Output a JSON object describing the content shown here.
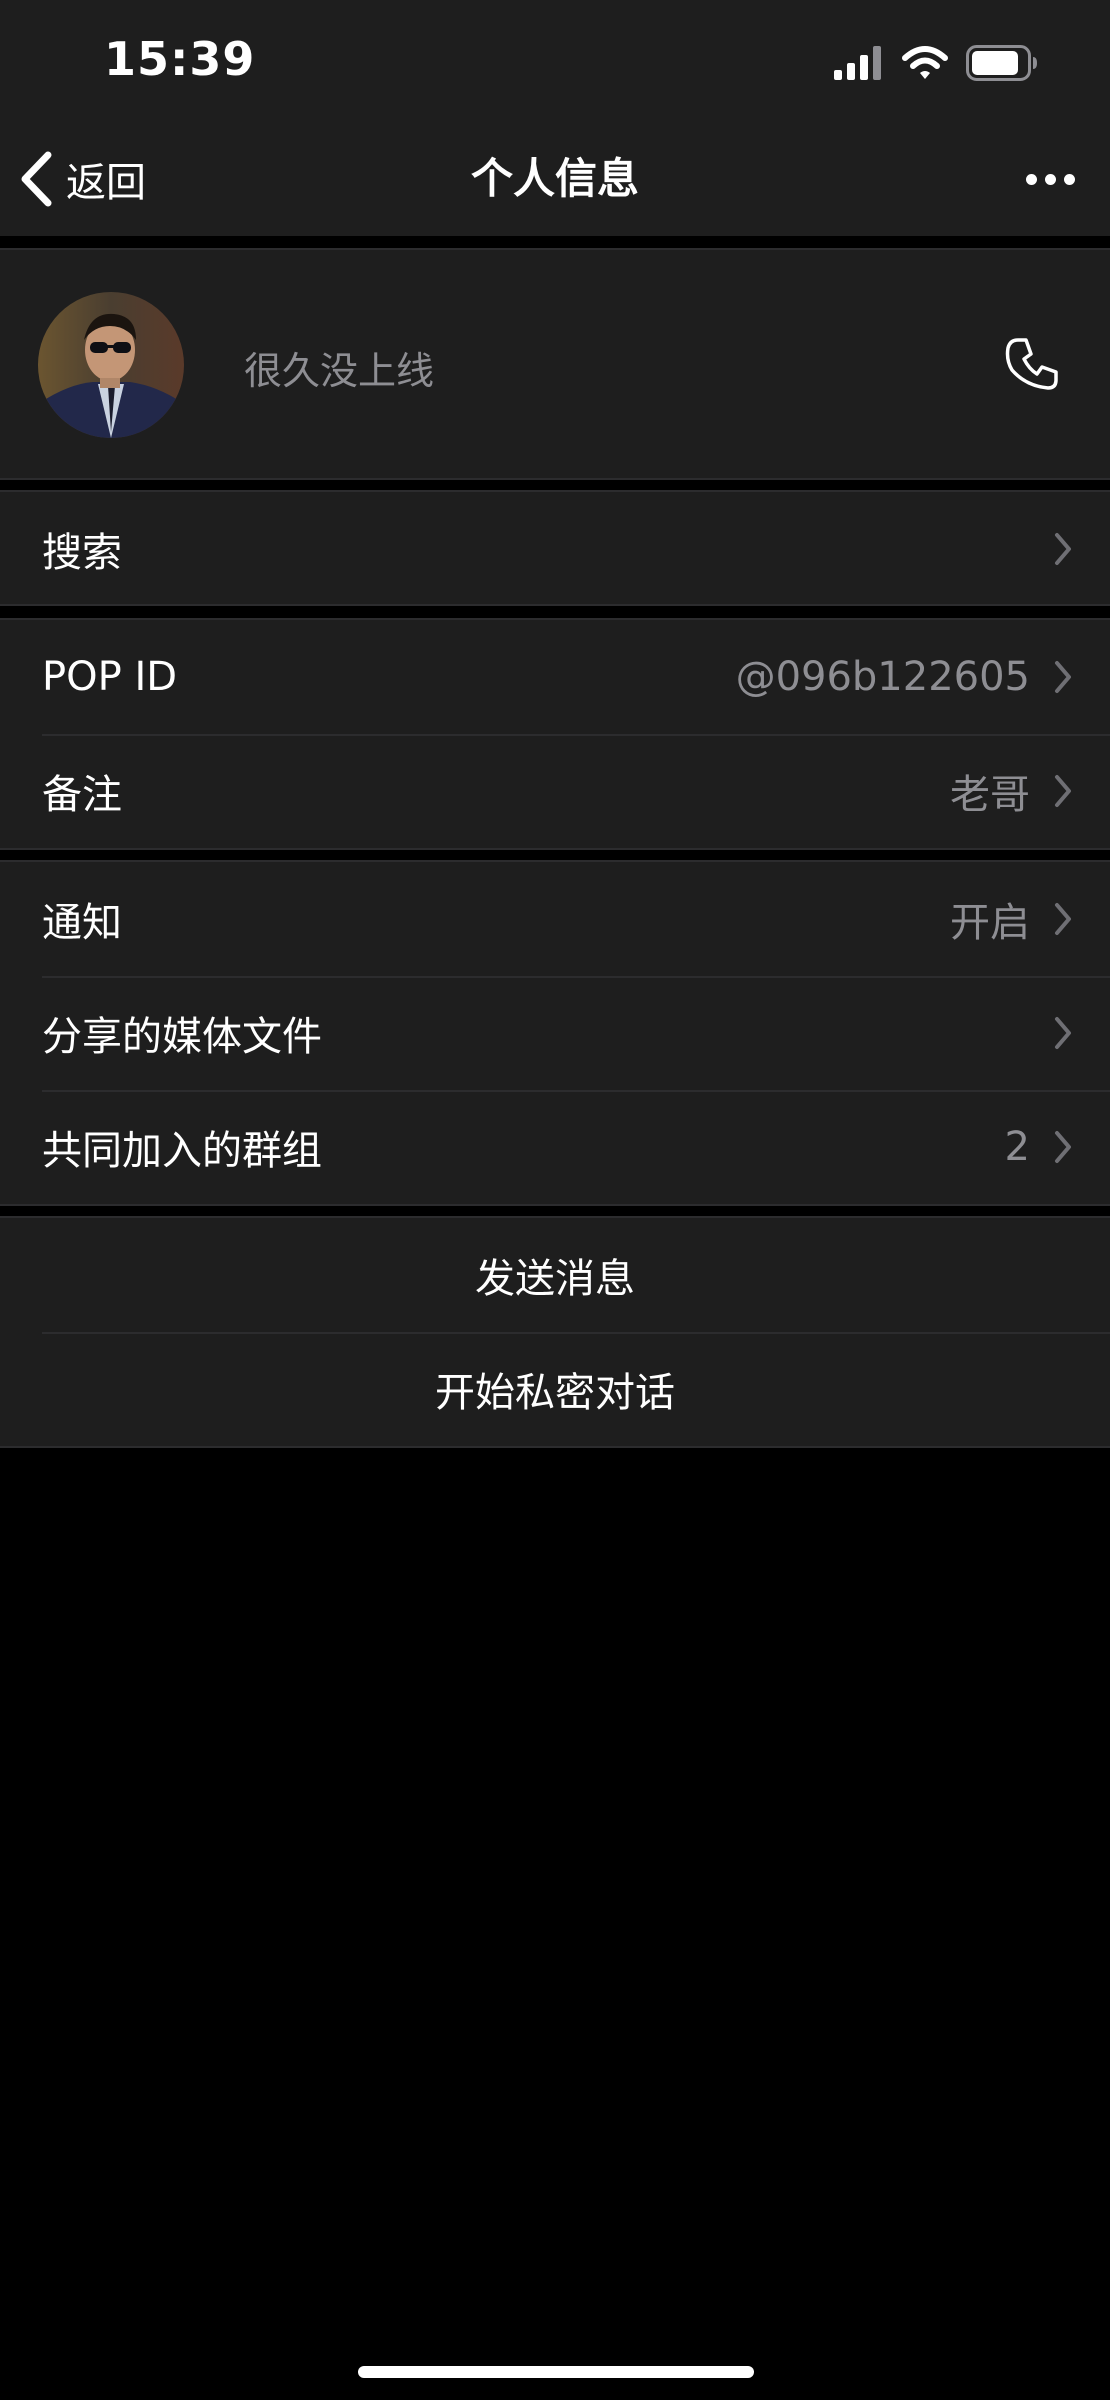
{
  "status_bar": {
    "time": "15:39",
    "icons": [
      "signal-icon",
      "wifi-icon",
      "battery-icon"
    ]
  },
  "nav": {
    "back_label": "返回",
    "title": "个人信息",
    "more_icon": "more-dots-icon"
  },
  "profile": {
    "status": "很久没上线",
    "call_icon": "phone-icon"
  },
  "search": {
    "label": "搜索"
  },
  "info_rows": [
    {
      "label": "POP ID",
      "value": "@096b122605"
    },
    {
      "label": "备注",
      "value": "老哥"
    }
  ],
  "settings_rows": [
    {
      "label": "通知",
      "value": "开启"
    },
    {
      "label": "分享的媒体文件",
      "value": ""
    },
    {
      "label": "共同加入的群组",
      "value": "2"
    }
  ],
  "actions": {
    "send_message": "发送消息",
    "secret_chat": "开始私密对话"
  },
  "colors": {
    "background": "#000000",
    "panel": "#1e1e1e",
    "separator": "#2c2c2e",
    "primary_text": "#ffffff",
    "secondary_text": "#8e8e93"
  }
}
